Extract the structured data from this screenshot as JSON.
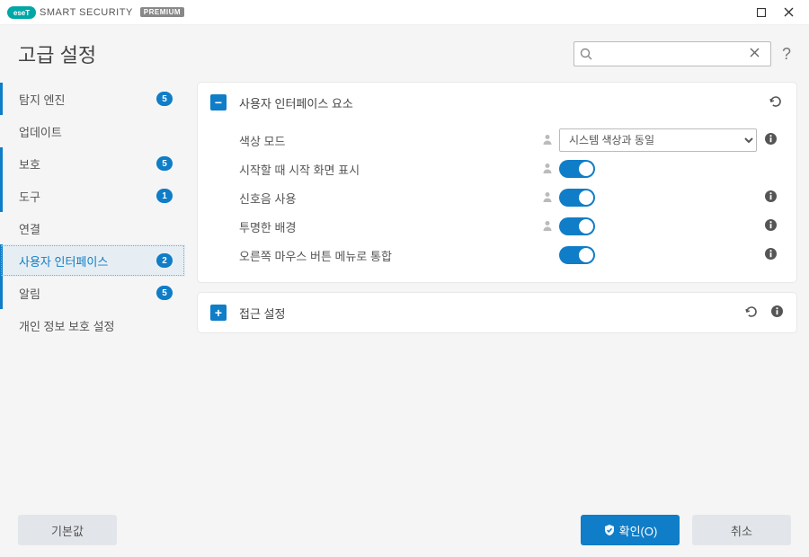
{
  "titlebar": {
    "brand": "SMART SECURITY",
    "edition": "PREMIUM"
  },
  "header": {
    "title": "고급 설정"
  },
  "sidebar": {
    "items": [
      {
        "label": "탐지 엔진",
        "badge": "5",
        "marked": true
      },
      {
        "label": "업데이트",
        "badge": null,
        "marked": false
      },
      {
        "label": "보호",
        "badge": "5",
        "marked": true
      },
      {
        "label": "도구",
        "badge": "1",
        "marked": true
      },
      {
        "label": "연결",
        "badge": null,
        "marked": false
      },
      {
        "label": "사용자 인터페이스",
        "badge": "2",
        "marked": true,
        "active": true
      },
      {
        "label": "알림",
        "badge": "5",
        "marked": true
      },
      {
        "label": "개인 정보 보호 설정",
        "badge": null,
        "marked": false
      }
    ]
  },
  "panels": {
    "uiElements": {
      "title": "사용자 인터페이스 요소",
      "rows": {
        "colorMode": {
          "label": "색상 모드",
          "value": "시스템 색상과 동일"
        },
        "splash": {
          "label": "시작할 때 시작 화면 표시"
        },
        "sound": {
          "label": "신호음 사용"
        },
        "transparentBg": {
          "label": "투명한 배경"
        },
        "contextMenu": {
          "label": "오른쪽 마우스 버튼 메뉴로 통합"
        }
      }
    },
    "access": {
      "title": "접근 설정"
    }
  },
  "footer": {
    "defaults": "기본값",
    "ok": "확인(O)",
    "cancel": "취소"
  }
}
